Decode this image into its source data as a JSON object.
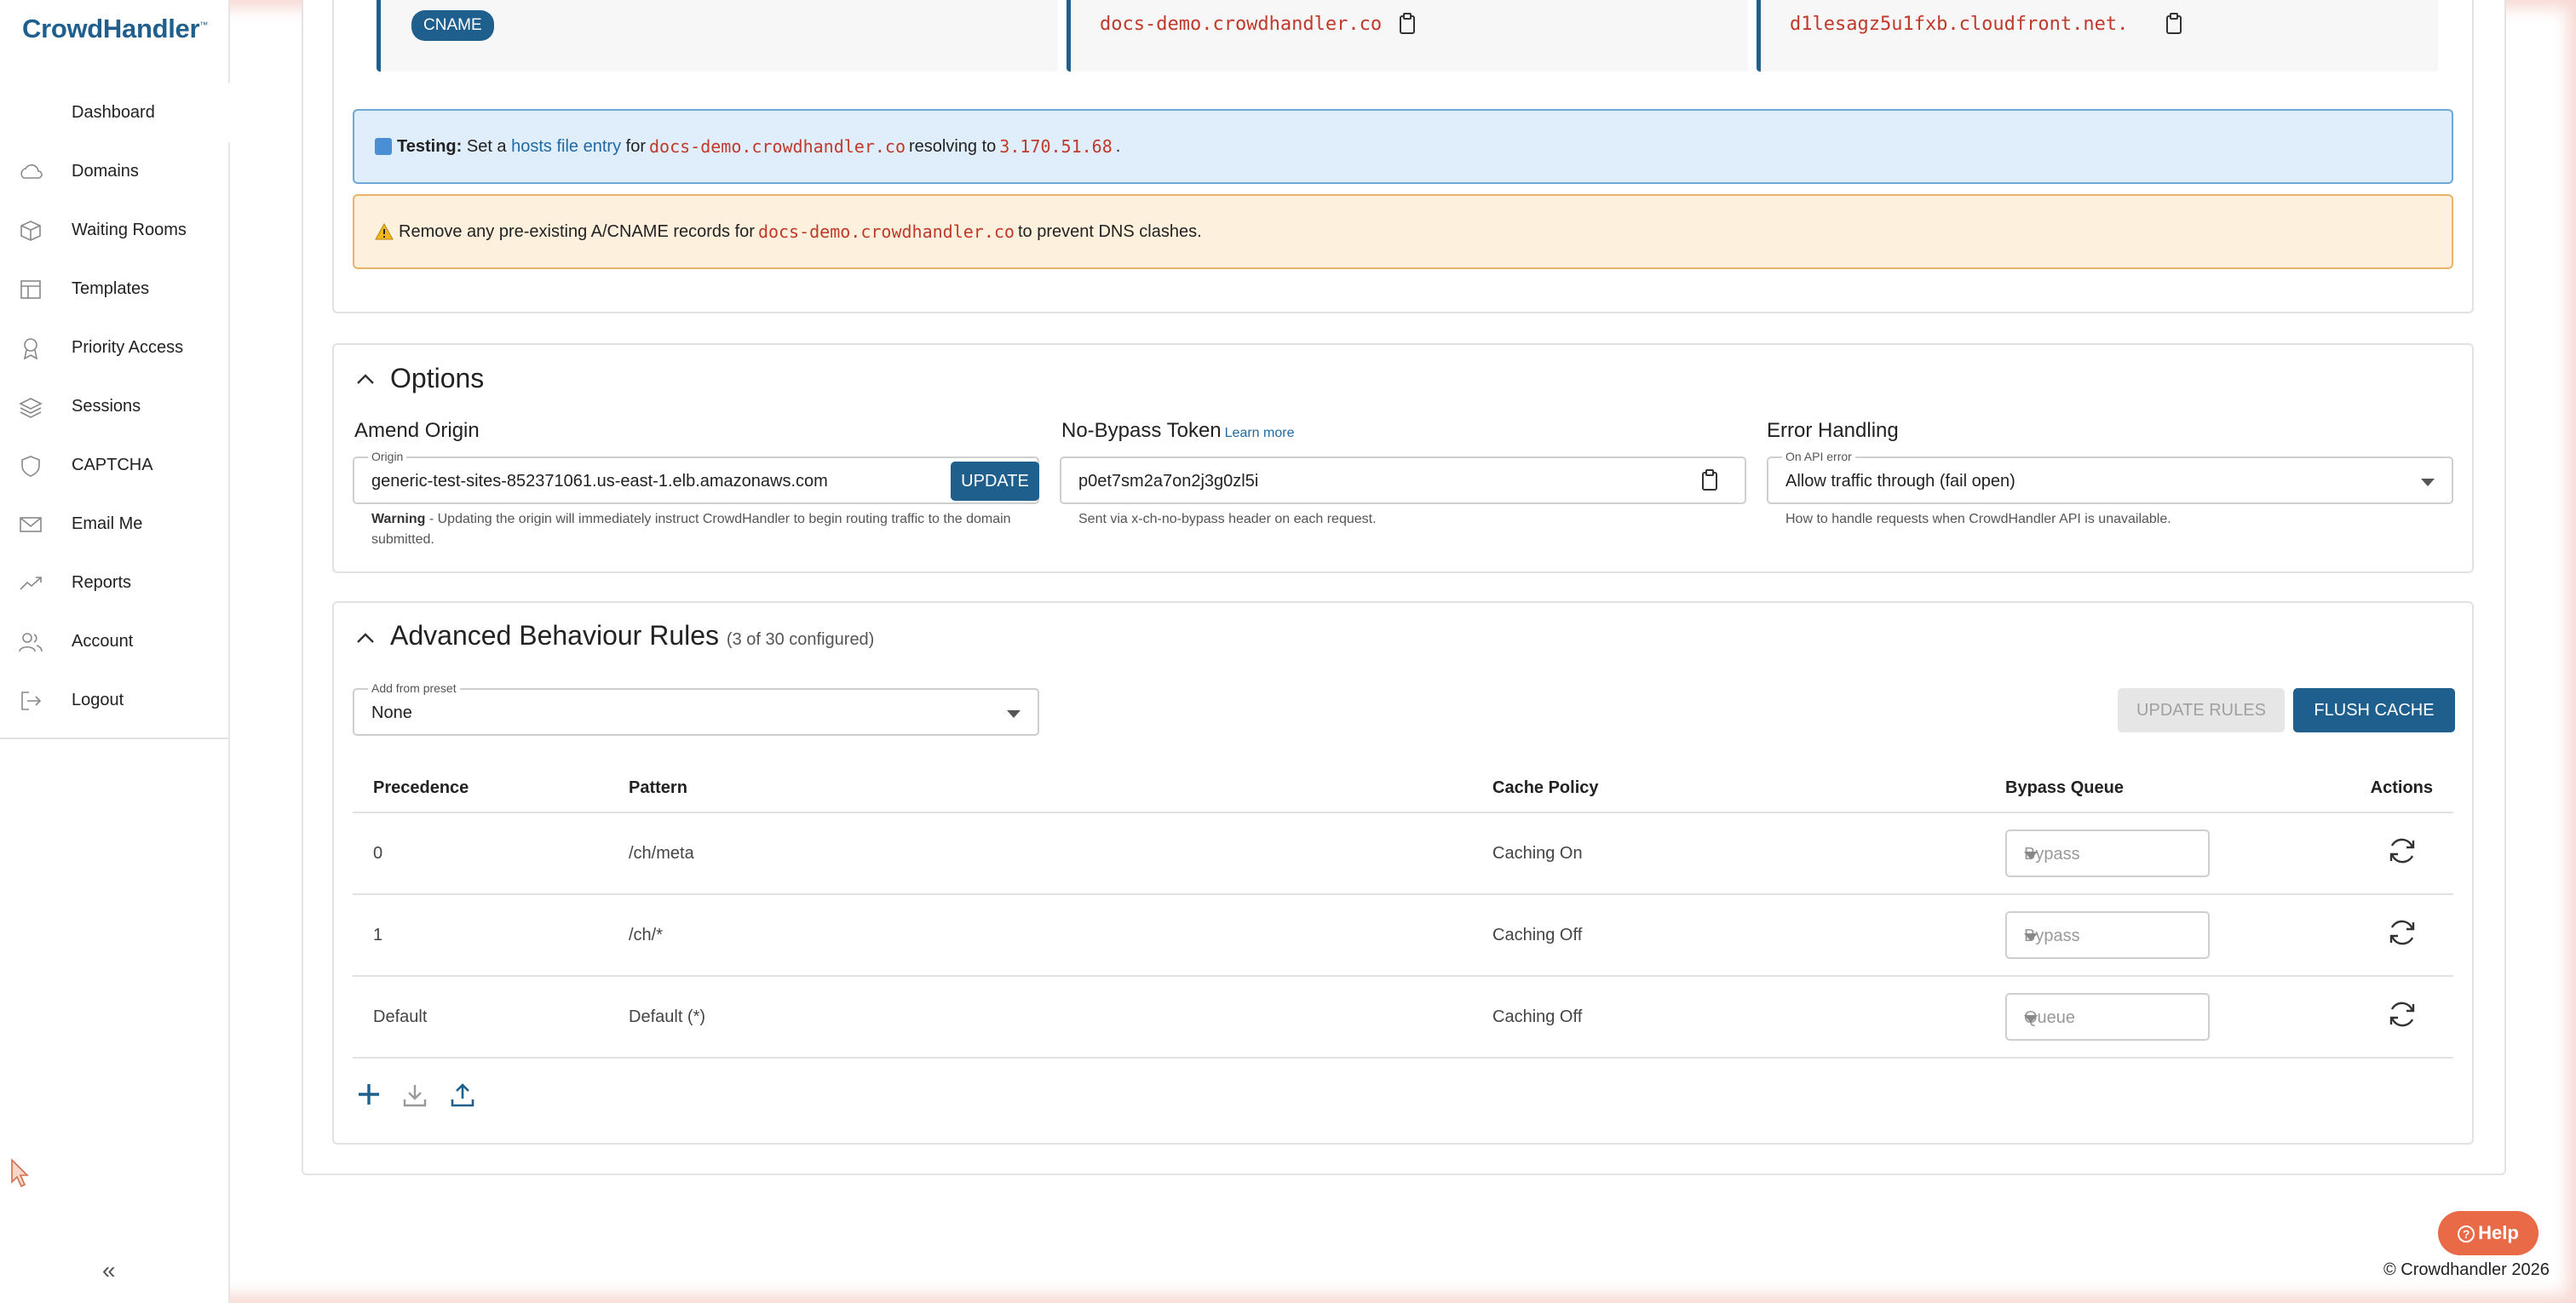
{
  "app": {
    "brand": "CrowdHandler",
    "brand_mark": "™"
  },
  "sidebar": {
    "items": [
      {
        "label": "Dashboard",
        "icon": "dashboard-icon"
      },
      {
        "label": "Domains",
        "icon": "cloud-icon"
      },
      {
        "label": "Waiting Rooms",
        "icon": "cube-icon"
      },
      {
        "label": "Templates",
        "icon": "layout-icon"
      },
      {
        "label": "Priority Access",
        "icon": "ribbon-icon"
      },
      {
        "label": "Sessions",
        "icon": "layers-icon"
      },
      {
        "label": "CAPTCHA",
        "icon": "shield-icon"
      },
      {
        "label": "Email Me",
        "icon": "mail-icon"
      },
      {
        "label": "Reports",
        "icon": "trend-icon"
      },
      {
        "label": "Account",
        "icon": "users-icon"
      },
      {
        "label": "Logout",
        "icon": "logout-icon"
      }
    ],
    "collapse_label": "«"
  },
  "dns": {
    "record_type": "CNAME",
    "name": "docs-demo.crowdhandler.co",
    "value": "d1lesagz5u1fxb.cloudfront.net."
  },
  "alerts": {
    "testing_label": "Testing:",
    "testing_pre": "Set a",
    "testing_link": "hosts file entry",
    "testing_for": "for",
    "testing_domain": "docs-demo.crowdhandler.co",
    "testing_mid": "resolving to",
    "testing_ip": "3.170.51.68",
    "testing_end": ".",
    "warn_pre": "Remove any pre-existing A/CNAME records for",
    "warn_domain": "docs-demo.crowdhandler.co",
    "warn_post": "to prevent DNS clashes."
  },
  "options": {
    "title": "Options",
    "amend_origin": {
      "title": "Amend Origin",
      "floating_label": "Origin",
      "value": "generic-test-sites-852371061.us-east-1.elb.amazonaws.com",
      "button": "UPDATE",
      "warning_bold": "Warning",
      "warning_text": " - Updating the origin will immediately instruct CrowdHandler to begin routing traffic to the domain submitted."
    },
    "bypass": {
      "title": "No-Bypass Token",
      "learn_more": "Learn more",
      "value": "p0et7sm2a7on2j3g0zl5i",
      "helper": "Sent via x-ch-no-bypass header on each request."
    },
    "error": {
      "title": "Error Handling",
      "floating_label": "On API error",
      "value": "Allow traffic through (fail open)",
      "helper": "How to handle requests when CrowdHandler API is unavailable."
    }
  },
  "rules": {
    "title": "Advanced Behaviour Rules",
    "count": "(3 of 30 configured)",
    "preset_label": "Add from preset",
    "preset_value": "None",
    "update_button": "UPDATE RULES",
    "flush_button": "FLUSH CACHE",
    "columns": [
      "Precedence",
      "Pattern",
      "Cache Policy",
      "Bypass Queue",
      "Actions"
    ],
    "rows": [
      {
        "precedence": "0",
        "pattern": "/ch/meta",
        "cache": "Caching On",
        "bypass": "Bypass"
      },
      {
        "precedence": "1",
        "pattern": "/ch/*",
        "cache": "Caching Off",
        "bypass": "Bypass"
      },
      {
        "precedence": "Default",
        "pattern": "Default (*)",
        "cache": "Caching Off",
        "bypass": "Queue"
      }
    ]
  },
  "help_button": "Help",
  "footer": "© Crowdhandler 2026",
  "colors": {
    "primary": "#1f5f8e",
    "accent": "#e96a46",
    "code": "#c0392b"
  }
}
